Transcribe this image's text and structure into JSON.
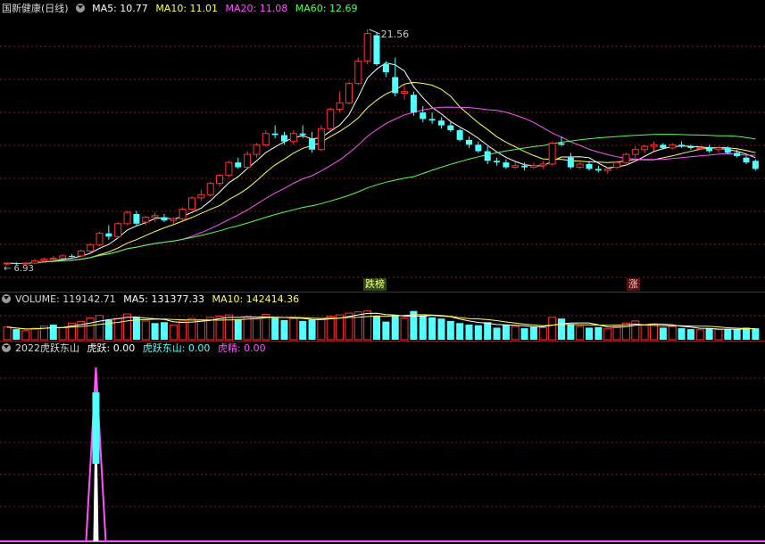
{
  "main": {
    "title": "国新健康(日线)",
    "ma5": "MA5: 10.77",
    "ma10": "MA10: 11.01",
    "ma20": "MA20: 11.08",
    "ma60": "MA60: 12.69",
    "high_label": "21.56",
    "low_label": "6.93",
    "signal_dieban": "跌榜",
    "signal_zhang": "涨"
  },
  "volume": {
    "label": "VOLUME: 119142.71",
    "ma5": "MA5: 131377.33",
    "ma10": "MA10: 142414.36"
  },
  "indicator": {
    "name": "2022虎跃东山",
    "huyue": "虎跃: 0.00",
    "huyue_dongshan": "虎跃东山: 0.00",
    "hujing": "虎精: 0.00"
  },
  "colors": {
    "up": "#ff3232",
    "down": "#54ffff",
    "ma5": "#ffffff",
    "ma10": "#ffff54",
    "ma20": "#ff54ff",
    "ma60": "#54ff54",
    "grid": "#8a1a1a"
  },
  "chart_data": {
    "type": "candlestick",
    "ylim": [
      6.5,
      22.5
    ],
    "candles": [
      [
        7.0,
        7.1,
        6.9,
        7.05
      ],
      [
        7.05,
        7.1,
        6.95,
        7.0
      ],
      [
        7.0,
        7.1,
        6.95,
        7.05
      ],
      [
        7.05,
        7.3,
        7.0,
        7.2
      ],
      [
        7.2,
        7.4,
        7.1,
        7.3
      ],
      [
        7.3,
        7.5,
        7.2,
        7.35
      ],
      [
        7.35,
        7.6,
        7.3,
        7.5
      ],
      [
        7.5,
        7.6,
        7.4,
        7.45
      ],
      [
        7.5,
        7.9,
        7.4,
        7.8
      ],
      [
        7.8,
        8.3,
        7.7,
        8.2
      ],
      [
        8.2,
        9.0,
        8.1,
        8.9
      ],
      [
        8.9,
        9.4,
        8.5,
        8.7
      ],
      [
        8.7,
        9.6,
        8.6,
        9.5
      ],
      [
        9.5,
        10.3,
        9.4,
        10.2
      ],
      [
        10.1,
        10.3,
        9.4,
        9.5
      ],
      [
        9.6,
        10.0,
        9.4,
        9.9
      ],
      [
        9.9,
        10.2,
        9.6,
        10.0
      ],
      [
        9.9,
        10.1,
        9.6,
        9.7
      ],
      [
        9.7,
        9.9,
        9.5,
        9.8
      ],
      [
        9.8,
        10.5,
        9.7,
        10.4
      ],
      [
        10.4,
        11.2,
        10.3,
        11.1
      ],
      [
        11.1,
        11.6,
        10.9,
        11.3
      ],
      [
        11.3,
        12.1,
        11.2,
        12.0
      ],
      [
        12.0,
        12.6,
        11.8,
        12.5
      ],
      [
        12.5,
        13.4,
        12.4,
        13.3
      ],
      [
        13.3,
        13.6,
        12.9,
        13.0
      ],
      [
        13.0,
        14.0,
        12.9,
        13.8
      ],
      [
        13.8,
        14.5,
        13.6,
        14.4
      ],
      [
        14.4,
        15.3,
        14.3,
        15.1
      ],
      [
        15.1,
        15.6,
        14.8,
        15.0
      ],
      [
        15.0,
        15.2,
        14.4,
        14.6
      ],
      [
        14.6,
        15.3,
        14.4,
        15.1
      ],
      [
        15.1,
        15.6,
        14.8,
        15.0
      ],
      [
        14.8,
        15.2,
        13.9,
        14.1
      ],
      [
        14.1,
        15.6,
        14.0,
        15.4
      ],
      [
        15.4,
        16.7,
        15.3,
        16.6
      ],
      [
        16.6,
        17.7,
        16.4,
        17.0
      ],
      [
        17.0,
        18.3,
        16.9,
        18.2
      ],
      [
        18.2,
        19.8,
        18.1,
        19.6
      ],
      [
        19.6,
        21.56,
        19.4,
        21.3
      ],
      [
        21.2,
        21.4,
        19.3,
        19.4
      ],
      [
        19.4,
        19.6,
        18.6,
        18.9
      ],
      [
        18.6,
        19.8,
        17.4,
        17.6
      ],
      [
        17.6,
        18.1,
        17.2,
        17.7
      ],
      [
        17.5,
        17.7,
        16.2,
        16.4
      ],
      [
        16.4,
        16.8,
        15.8,
        16.0
      ],
      [
        16.0,
        16.4,
        15.7,
        15.9
      ],
      [
        15.9,
        16.1,
        15.4,
        15.6
      ],
      [
        15.6,
        15.8,
        15.2,
        15.3
      ],
      [
        15.3,
        15.4,
        14.6,
        14.7
      ],
      [
        14.7,
        14.9,
        14.2,
        14.4
      ],
      [
        14.4,
        14.6,
        13.9,
        14.0
      ],
      [
        14.0,
        14.3,
        13.2,
        13.4
      ],
      [
        13.4,
        13.6,
        13.1,
        13.3
      ],
      [
        13.3,
        13.5,
        12.9,
        13.0
      ],
      [
        13.0,
        13.3,
        12.9,
        13.1
      ],
      [
        13.1,
        13.3,
        12.8,
        13.0
      ],
      [
        13.0,
        13.3,
        12.9,
        13.1
      ],
      [
        13.1,
        13.4,
        12.9,
        13.2
      ],
      [
        13.2,
        14.6,
        13.1,
        14.5
      ],
      [
        14.5,
        14.9,
        14.3,
        14.4
      ],
      [
        13.6,
        13.9,
        12.9,
        13.0
      ],
      [
        13.0,
        13.3,
        12.9,
        13.2
      ],
      [
        13.2,
        13.4,
        12.8,
        12.9
      ],
      [
        12.9,
        13.1,
        12.7,
        12.8
      ],
      [
        12.8,
        13.0,
        12.6,
        12.9
      ],
      [
        13.0,
        13.4,
        12.9,
        13.3
      ],
      [
        13.3,
        13.9,
        13.1,
        13.8
      ],
      [
        13.8,
        14.3,
        13.5,
        14.1
      ],
      [
        14.1,
        14.4,
        13.9,
        14.3
      ],
      [
        14.3,
        14.6,
        14.0,
        14.4
      ],
      [
        14.4,
        14.5,
        14.1,
        14.2
      ],
      [
        14.2,
        14.5,
        14.1,
        14.4
      ],
      [
        14.4,
        14.6,
        14.2,
        14.3
      ],
      [
        14.3,
        14.4,
        14.1,
        14.2
      ],
      [
        14.2,
        14.3,
        14.1,
        14.2
      ],
      [
        14.2,
        14.4,
        13.9,
        14.0
      ],
      [
        14.1,
        14.3,
        13.9,
        14.2
      ],
      [
        14.2,
        14.3,
        13.8,
        13.9
      ],
      [
        13.9,
        14.1,
        13.6,
        13.7
      ],
      [
        13.6,
        13.7,
        13.2,
        13.3
      ],
      [
        13.4,
        13.5,
        12.8,
        12.9
      ]
    ],
    "volume": [
      [
        0.42,
        1
      ],
      [
        0.35,
        0
      ],
      [
        0.3,
        1
      ],
      [
        0.38,
        1
      ],
      [
        0.45,
        1
      ],
      [
        0.5,
        0
      ],
      [
        0.4,
        1
      ],
      [
        0.55,
        1
      ],
      [
        0.6,
        1
      ],
      [
        0.72,
        1
      ],
      [
        0.8,
        1
      ],
      [
        0.65,
        0
      ],
      [
        0.7,
        1
      ],
      [
        0.85,
        1
      ],
      [
        0.75,
        0
      ],
      [
        0.62,
        1
      ],
      [
        0.55,
        0
      ],
      [
        0.58,
        0
      ],
      [
        0.48,
        1
      ],
      [
        0.62,
        1
      ],
      [
        0.7,
        1
      ],
      [
        0.66,
        1
      ],
      [
        0.74,
        1
      ],
      [
        0.78,
        1
      ],
      [
        0.82,
        1
      ],
      [
        0.68,
        0
      ],
      [
        0.76,
        1
      ],
      [
        0.7,
        1
      ],
      [
        0.84,
        1
      ],
      [
        0.72,
        0
      ],
      [
        0.65,
        0
      ],
      [
        0.7,
        1
      ],
      [
        0.62,
        0
      ],
      [
        0.66,
        0
      ],
      [
        0.7,
        1
      ],
      [
        0.78,
        1
      ],
      [
        0.82,
        1
      ],
      [
        0.88,
        1
      ],
      [
        0.92,
        1
      ],
      [
        0.95,
        1
      ],
      [
        0.8,
        0
      ],
      [
        0.6,
        0
      ],
      [
        0.82,
        0
      ],
      [
        0.72,
        1
      ],
      [
        0.95,
        0
      ],
      [
        0.8,
        0
      ],
      [
        0.74,
        0
      ],
      [
        0.7,
        0
      ],
      [
        0.62,
        0
      ],
      [
        0.55,
        0
      ],
      [
        0.5,
        0
      ],
      [
        0.48,
        0
      ],
      [
        0.58,
        0
      ],
      [
        0.4,
        0
      ],
      [
        0.5,
        0
      ],
      [
        0.44,
        1
      ],
      [
        0.38,
        0
      ],
      [
        0.42,
        0
      ],
      [
        0.4,
        1
      ],
      [
        0.74,
        1
      ],
      [
        0.7,
        0
      ],
      [
        0.5,
        0
      ],
      [
        0.44,
        1
      ],
      [
        0.4,
        0
      ],
      [
        0.42,
        0
      ],
      [
        0.36,
        1
      ],
      [
        0.44,
        1
      ],
      [
        0.55,
        1
      ],
      [
        0.62,
        1
      ],
      [
        0.48,
        1
      ],
      [
        0.52,
        1
      ],
      [
        0.4,
        0
      ],
      [
        0.44,
        1
      ],
      [
        0.38,
        0
      ],
      [
        0.35,
        0
      ],
      [
        0.33,
        1
      ],
      [
        0.37,
        0
      ],
      [
        0.34,
        1
      ],
      [
        0.36,
        0
      ],
      [
        0.34,
        0
      ],
      [
        0.4,
        0
      ],
      [
        0.38,
        0
      ]
    ],
    "indicator_spike_index": 7
  }
}
